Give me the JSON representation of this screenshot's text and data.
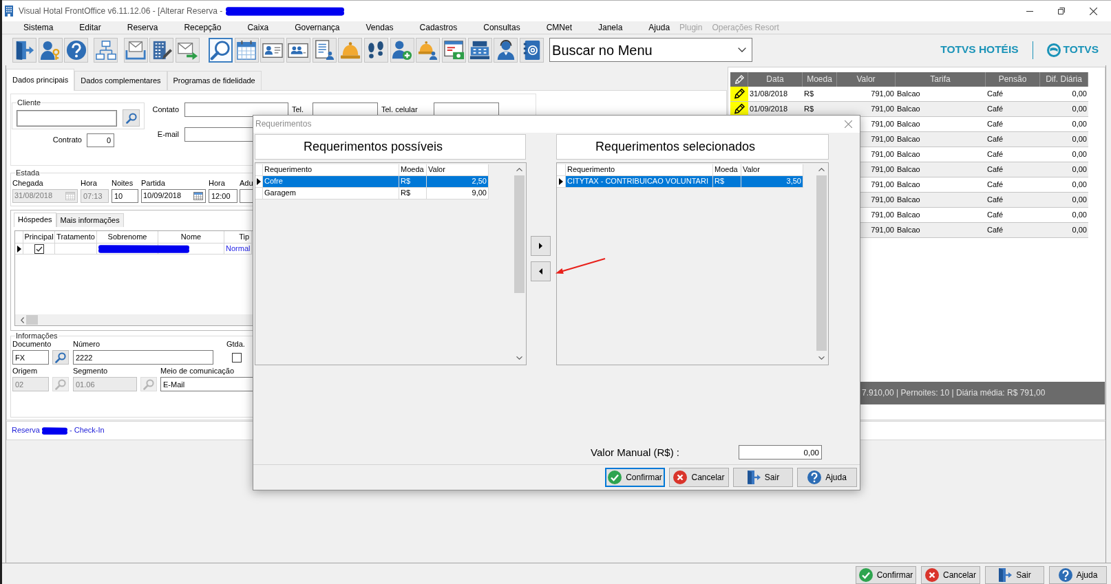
{
  "window": {
    "title": "Visual Hotal FrontOffice v6.11.12.06 - [Alterar Reserva -",
    "redacted": true
  },
  "menu": [
    {
      "label": "Sistema",
      "disabled": false
    },
    {
      "label": "Editar",
      "disabled": false
    },
    {
      "label": "Reserva",
      "disabled": false
    },
    {
      "label": "Recepção",
      "disabled": false
    },
    {
      "label": "Caixa",
      "disabled": false
    },
    {
      "label": "Governança",
      "disabled": false
    },
    {
      "label": "Vendas",
      "disabled": false
    },
    {
      "label": "Cadastros",
      "disabled": false
    },
    {
      "label": "Consultas",
      "disabled": false
    },
    {
      "label": "CMNet",
      "disabled": false
    },
    {
      "label": "Janela",
      "disabled": false
    },
    {
      "label": "Ajuda",
      "disabled": false
    },
    {
      "label": "Plugin",
      "disabled": true
    },
    {
      "label": "Operações Resort",
      "disabled": true
    }
  ],
  "toolbar_buttons": [
    {
      "selected": false
    },
    {
      "selected": false
    },
    {
      "selected": false
    },
    {
      "selected": false
    },
    {
      "selected": false
    },
    {
      "selected": false
    },
    {
      "selected": false
    },
    {
      "selected": true
    },
    {
      "selected": false
    },
    {
      "selected": false
    },
    {
      "selected": false
    },
    {
      "selected": false
    },
    {
      "selected": false
    },
    {
      "selected": false
    },
    {
      "selected": false
    },
    {
      "selected": false
    },
    {
      "selected": false
    },
    {
      "selected": false
    },
    {
      "selected": false
    },
    {
      "selected": false
    }
  ],
  "menu_search": {
    "value": "Buscar no Menu"
  },
  "brand": {
    "product": "TOTVS HOTÉIS",
    "company": "TOTVS"
  },
  "form": {
    "tabs": [
      {
        "label": "Dados principais",
        "selected": true
      },
      {
        "label": "Dados complementares",
        "selected": false
      },
      {
        "label": "Programas de fidelidade",
        "selected": false
      }
    ],
    "cliente": {
      "legend": "Cliente"
    },
    "contact_fields": [
      {
        "label": "Contato"
      },
      {
        "label": "Tel."
      },
      {
        "label": "Tel. celular"
      }
    ],
    "email": {
      "label": "E-mail"
    },
    "contrato": {
      "label": "Contrato",
      "value": "0"
    },
    "estada": {
      "legend": "Estada",
      "fields": [
        {
          "label": "Chegada",
          "value": "31/08/2018",
          "kind": "date",
          "disabled": true
        },
        {
          "label": "Hora",
          "value": "07:13",
          "kind": "text",
          "disabled": true
        },
        {
          "label": "Noites",
          "value": "10",
          "kind": "text",
          "disabled": false
        },
        {
          "label": "Partida",
          "value": "10/09/2018",
          "kind": "date",
          "disabled": false
        },
        {
          "label": "Hora",
          "value": "12:00",
          "kind": "text",
          "disabled": false
        },
        {
          "label": "Adu",
          "kind": "text",
          "disabled": false
        }
      ]
    },
    "hospedes": {
      "tabs": [
        {
          "label": "Hóspedes",
          "selected": true
        },
        {
          "label": "Mais informações",
          "selected": false
        }
      ],
      "columns": [
        "Principal",
        "Tratamento",
        "Sobrenome",
        "Nome",
        "Tip"
      ],
      "rows": [
        {
          "current": true,
          "principal": true,
          "redacted": true,
          "tipo": "Normal"
        }
      ]
    },
    "informacoes": {
      "legend": "Informações",
      "fields": [
        {
          "label": "Documento",
          "value": "FX",
          "kind": "lookup",
          "disabled": false
        },
        {
          "label": "Número",
          "value": "2222",
          "kind": "text",
          "disabled": false
        },
        {
          "label": "Gtda.",
          "kind": "checkbox",
          "checked": false,
          "disabled": false
        },
        {
          "label": "Origem",
          "value": "02",
          "kind": "lookup",
          "disabled": true
        },
        {
          "label": "Segmento",
          "value": "01.06",
          "kind": "lookup",
          "disabled": true
        },
        {
          "label": "Meio de comunicação",
          "value": "E-Mail",
          "kind": "text",
          "disabled": false
        }
      ]
    }
  },
  "status_line": {
    "prefix": "Reserva",
    "suffix": "- Check-In",
    "redacted": true
  },
  "diarias": {
    "columns": [
      "Data",
      "Moeda",
      "Valor",
      "Tarifa",
      "Pensão",
      "Dif. Diária"
    ],
    "rows": [
      {
        "marked": true,
        "data": "31/08/2018",
        "moeda": "R$",
        "valor": "791,00",
        "tarifa": "Balcao",
        "pensao": "Café",
        "dif": "0,00"
      },
      {
        "marked": true,
        "data": "01/09/2018",
        "moeda": "R$",
        "valor": "791,00",
        "tarifa": "Balcao",
        "pensao": "Café",
        "dif": "0,00"
      },
      {
        "valor": "791,00",
        "tarifa": "Balcao",
        "pensao": "Café",
        "dif": "0,00"
      },
      {
        "valor": "791,00",
        "tarifa": "Balcao",
        "pensao": "Café",
        "dif": "0,00"
      },
      {
        "valor": "791,00",
        "tarifa": "Balcao",
        "pensao": "Café",
        "dif": "0,00"
      },
      {
        "valor": "791,00",
        "tarifa": "Balcao",
        "pensao": "Café",
        "dif": "0,00"
      },
      {
        "valor": "791,00",
        "tarifa": "Balcao",
        "pensao": "Café",
        "dif": "0,00"
      },
      {
        "valor": "791,00",
        "tarifa": "Balcao",
        "pensao": "Café",
        "dif": "0,00"
      },
      {
        "valor": "791,00",
        "tarifa": "Balcao",
        "pensao": "Café",
        "dif": "0,00"
      },
      {
        "valor": "791,00",
        "tarifa": "Balcao",
        "pensao": "Café",
        "dif": "0,00"
      }
    ],
    "summary": "7.910,00 | Pernoites: 10 | Diária média: R$ 791,00"
  },
  "dialog": {
    "title": "Requerimentos",
    "lists": [
      {
        "title": "Requerimentos possíveis",
        "columns": [
          "Requerimento",
          "Moeda",
          "Valor"
        ],
        "rows": [
          {
            "name": "Cofre",
            "moeda": "R$",
            "valor": "2,50",
            "selected": true
          },
          {
            "name": "Garagem",
            "moeda": "R$",
            "valor": "9,00",
            "selected": false
          }
        ]
      },
      {
        "title": "Requerimentos selecionados",
        "columns": [
          "Requerimento",
          "Moeda",
          "Valor"
        ],
        "rows": [
          {
            "name": "CITYTAX - CONTRIBUICAO VOLUNTARI",
            "moeda": "R$",
            "valor": "3,50",
            "selected": true
          }
        ]
      }
    ],
    "manual_value": {
      "label": "Valor Manual (R$) :",
      "value": "0,00"
    },
    "buttons": [
      {
        "label": "Confirmar",
        "kind": "confirm",
        "focused": true
      },
      {
        "label": "Cancelar",
        "kind": "cancel",
        "focused": false
      },
      {
        "label": "Sair",
        "kind": "exit",
        "focused": false
      },
      {
        "label": "Ajuda",
        "kind": "help",
        "focused": false
      }
    ]
  },
  "footer_buttons": [
    {
      "label": "Confirmar",
      "kind": "confirm"
    },
    {
      "label": "Cancelar",
      "kind": "cancel"
    },
    {
      "label": "Sair",
      "kind": "exit"
    },
    {
      "label": "Ajuda",
      "kind": "help"
    }
  ]
}
